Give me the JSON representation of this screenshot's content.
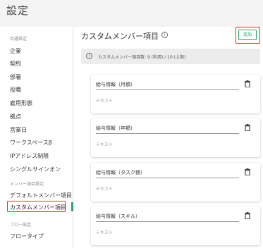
{
  "page": {
    "title": "設定"
  },
  "sidebar": {
    "sections": [
      {
        "label": "共通設定"
      },
      {
        "label": "メンバー項目設定"
      },
      {
        "label": "フロー設定"
      }
    ],
    "items": [
      {
        "label": "企業"
      },
      {
        "label": "契約"
      },
      {
        "label": "部署"
      },
      {
        "label": "役職"
      },
      {
        "label": "雇用形態"
      },
      {
        "label": "拠点"
      },
      {
        "label": "営業日"
      },
      {
        "label": "ワークスペースβ"
      },
      {
        "label": "IPアドレス制限"
      },
      {
        "label": "シングルサインオン"
      },
      {
        "label": "デフォルトメンバー項目"
      },
      {
        "label": "カスタムメンバー項目"
      },
      {
        "label": "フロータイプ"
      }
    ],
    "active_color": "#27a56b"
  },
  "main": {
    "title": "カスタムメンバー項目",
    "info_glyph": "i",
    "add_label": "追加",
    "infobar_text": "カスタムメンバー項目数: 9 (利用) / 10 (上限)",
    "fields": [
      {
        "label": "給与情報（月額）",
        "type": "テキスト"
      },
      {
        "label": "給与情報（年額）",
        "type": "テキスト"
      },
      {
        "label": "給与情報（タスク額）",
        "type": "テキスト"
      },
      {
        "label": "給与情報（スキル）",
        "type": "テキスト"
      }
    ]
  },
  "colors": {
    "accent": "#27a56b",
    "highlight": "#d9342b"
  }
}
